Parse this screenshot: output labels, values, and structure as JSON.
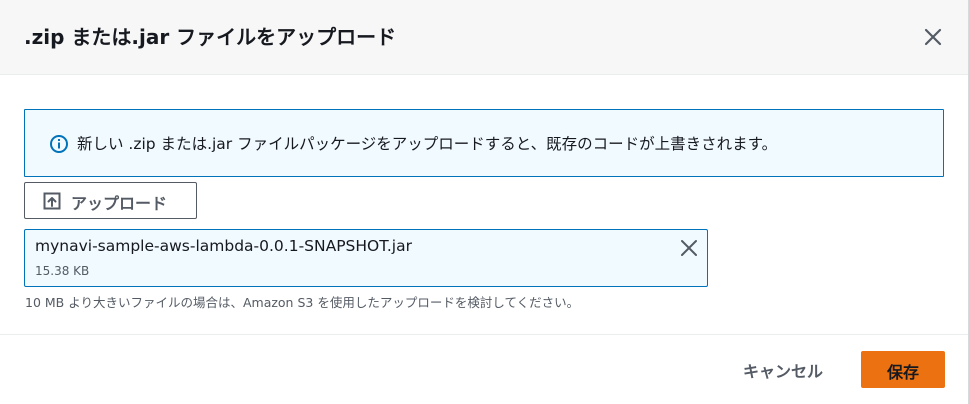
{
  "modal": {
    "title": ".zip または.jar ファイルをアップロード",
    "close_icon": "close-icon"
  },
  "info_alert": {
    "icon": "info-icon",
    "text": "新しい .zip または.jar ファイルパッケージをアップロードすると、既存のコードが上書きされます。"
  },
  "upload": {
    "button_label": "アップロード",
    "icon": "upload-icon"
  },
  "file": {
    "name": "mynavi-sample-aws-lambda-0.0.1-SNAPSHOT.jar",
    "size": "15.38 KB",
    "remove_icon": "close-icon"
  },
  "constraint": {
    "text": "10 MB より大きいファイルの場合は、Amazon S3 を使用したアップロードを検討してください。"
  },
  "footer": {
    "cancel_label": "キャンセル",
    "save_label": "保存"
  },
  "colors": {
    "primary_button": "#ec7211",
    "info_border": "#0073bb",
    "info_background": "#f1faff",
    "header_background": "#f7f7f7"
  }
}
